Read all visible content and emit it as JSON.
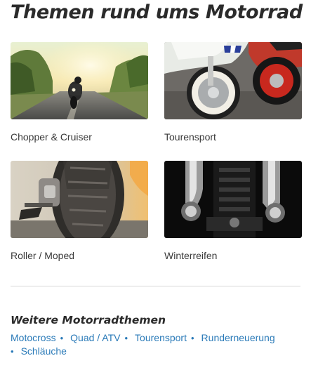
{
  "page": {
    "title": "Themen rund ums Motorrad"
  },
  "cards": [
    {
      "label": "Chopper & Cruiser",
      "image": "motorcycle-on-road-sunset"
    },
    {
      "label": "Tourensport",
      "image": "scooter-wheels-closeup"
    },
    {
      "label": "Roller / Moped",
      "image": "motorcycle-tire-closeup"
    },
    {
      "label": "Winterreifen",
      "image": "motorcycle-engine-exhaust-chrome"
    }
  ],
  "more": {
    "title": "Weitere Motorradthemen",
    "links": [
      "Motocross",
      "Quad / ATV",
      "Tourensport",
      "Runderneuerung",
      "Schläuche"
    ]
  },
  "colors": {
    "link": "#2a7ab8",
    "heading": "#2b2b2b",
    "divider": "#d7d7d7"
  }
}
